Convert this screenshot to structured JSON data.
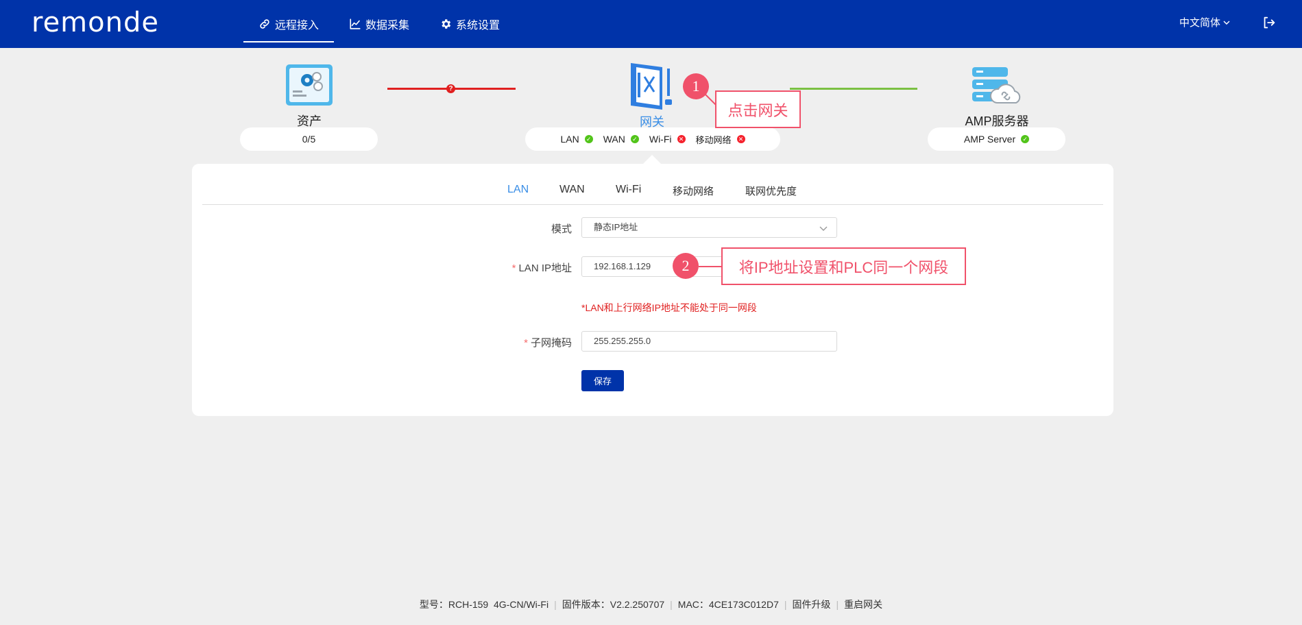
{
  "header": {
    "logo": "remonde",
    "nav": [
      {
        "label": "远程接入",
        "icon": "link-icon"
      },
      {
        "label": "数据采集",
        "icon": "chart-icon"
      },
      {
        "label": "系统设置",
        "icon": "gear-icon"
      }
    ],
    "language": "中文简体"
  },
  "topology": {
    "asset": {
      "title": "资产",
      "count": "0/5"
    },
    "gateway": {
      "title": "网关",
      "status": [
        {
          "label": "LAN",
          "state": "ok"
        },
        {
          "label": "WAN",
          "state": "ok"
        },
        {
          "label": "Wi-Fi",
          "state": "error"
        },
        {
          "label": "移动网络",
          "state": "error"
        }
      ]
    },
    "server": {
      "title": "AMP服务器",
      "status_label": "AMP Server",
      "state": "ok"
    },
    "link_asset_gateway_unknown": "?"
  },
  "annotations": {
    "step1": {
      "number": "1",
      "text": "点击网关"
    },
    "step2": {
      "number": "2",
      "text": "将IP地址设置和PLC同一个网段"
    }
  },
  "tabs": [
    "LAN",
    "WAN",
    "Wi-Fi",
    "移动网络",
    "联网优先度"
  ],
  "form": {
    "mode": {
      "label": "模式",
      "value": "静态IP地址"
    },
    "lan_ip": {
      "required": "*",
      "label": "LAN IP地址",
      "value": "192.168.1.129"
    },
    "warning": "*LAN和上行网络IP地址不能处于同一网段",
    "subnet": {
      "required": "*",
      "label": "子网掩码",
      "value": "255.255.255.0"
    },
    "save_label": "保存"
  },
  "footer": {
    "model": "型号：RCH-159  4G-CN/Wi-Fi",
    "firmware": "固件版本：V2.2.250707",
    "mac": "MAC：4CE173C012D7",
    "upgrade": "固件升级",
    "reboot": "重启网关"
  },
  "colors": {
    "header_bg": "#0033a9",
    "active_tab": "#3a8ee6",
    "annotation": "#f0516a",
    "ok": "#52c41a",
    "error": "#f5222d",
    "warning_text": "#e02020"
  }
}
